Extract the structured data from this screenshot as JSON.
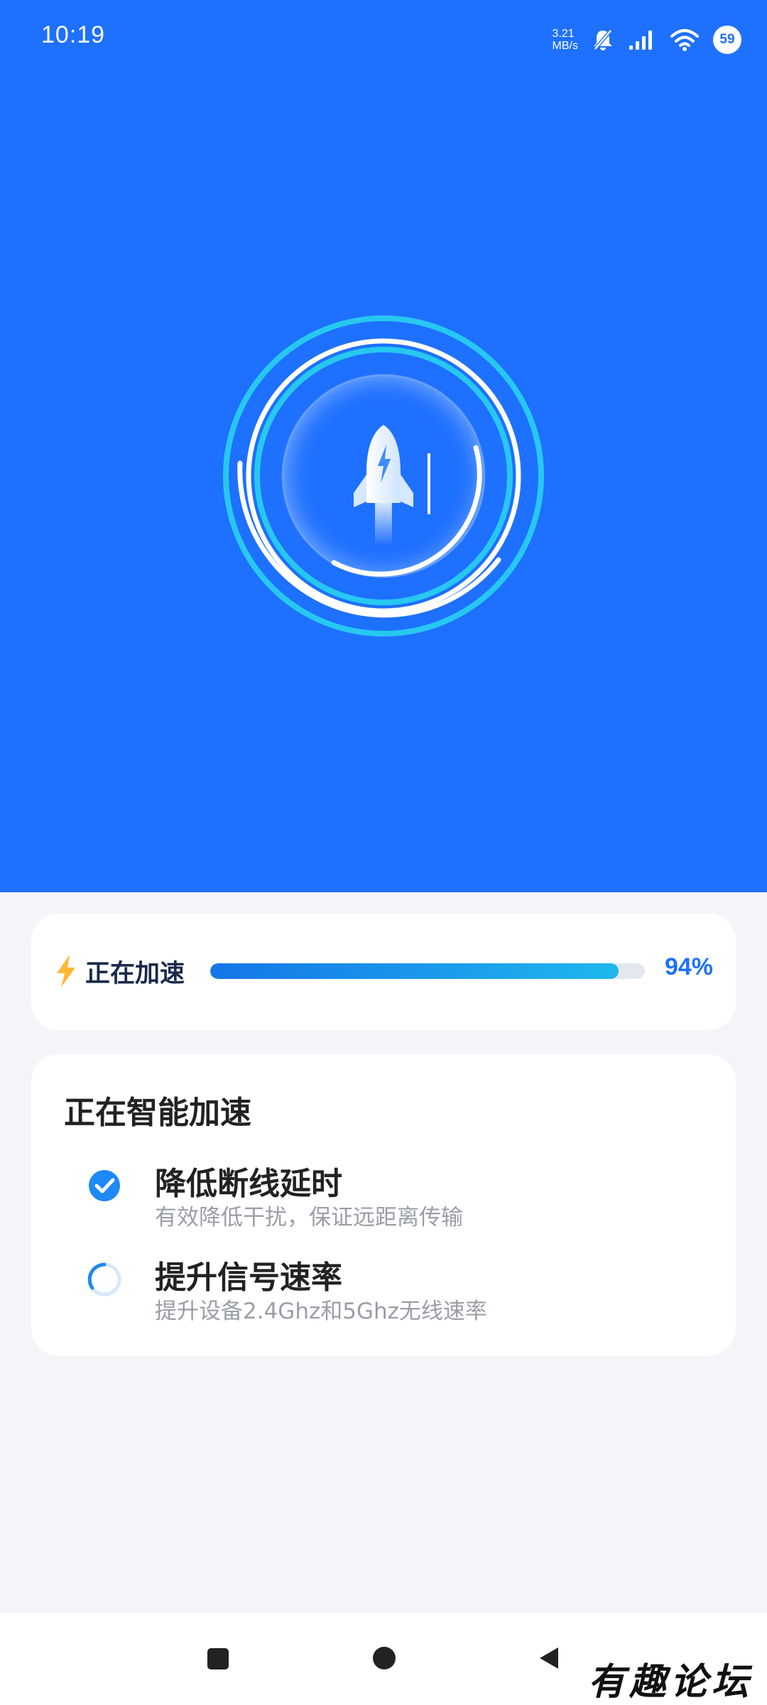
{
  "status_bar": {
    "time": "10:19",
    "net_speed_value": "3.21",
    "net_speed_unit": "MB/s",
    "battery": "59",
    "icons": [
      "mute-bell-icon",
      "signal-icon",
      "wifi-icon",
      "battery-icon"
    ]
  },
  "hero": {
    "background": "#1e70ff",
    "icon": "rocket-icon"
  },
  "progress": {
    "label": "正在加速",
    "percent_text": "94%",
    "value": 0.94,
    "icon": "lightning-icon"
  },
  "tasks": {
    "title": "正在智能加速",
    "items": [
      {
        "title": "降低断线延时",
        "desc": "有效降低干扰，保证远距离传输",
        "state": "done",
        "icon": "check-circle-icon"
      },
      {
        "title": "提升信号速率",
        "desc": "提升设备2.4Ghz和5Ghz无线速率",
        "state": "loading",
        "icon": "spinner-icon"
      }
    ]
  },
  "nav": {
    "icons": [
      "recents-square-icon",
      "home-circle-icon",
      "back-triangle-icon"
    ]
  },
  "watermark": "有趣论坛",
  "colors": {
    "accent": "#1e70ff",
    "cyan": "#27c8f0",
    "bolt": "#ffb833"
  }
}
